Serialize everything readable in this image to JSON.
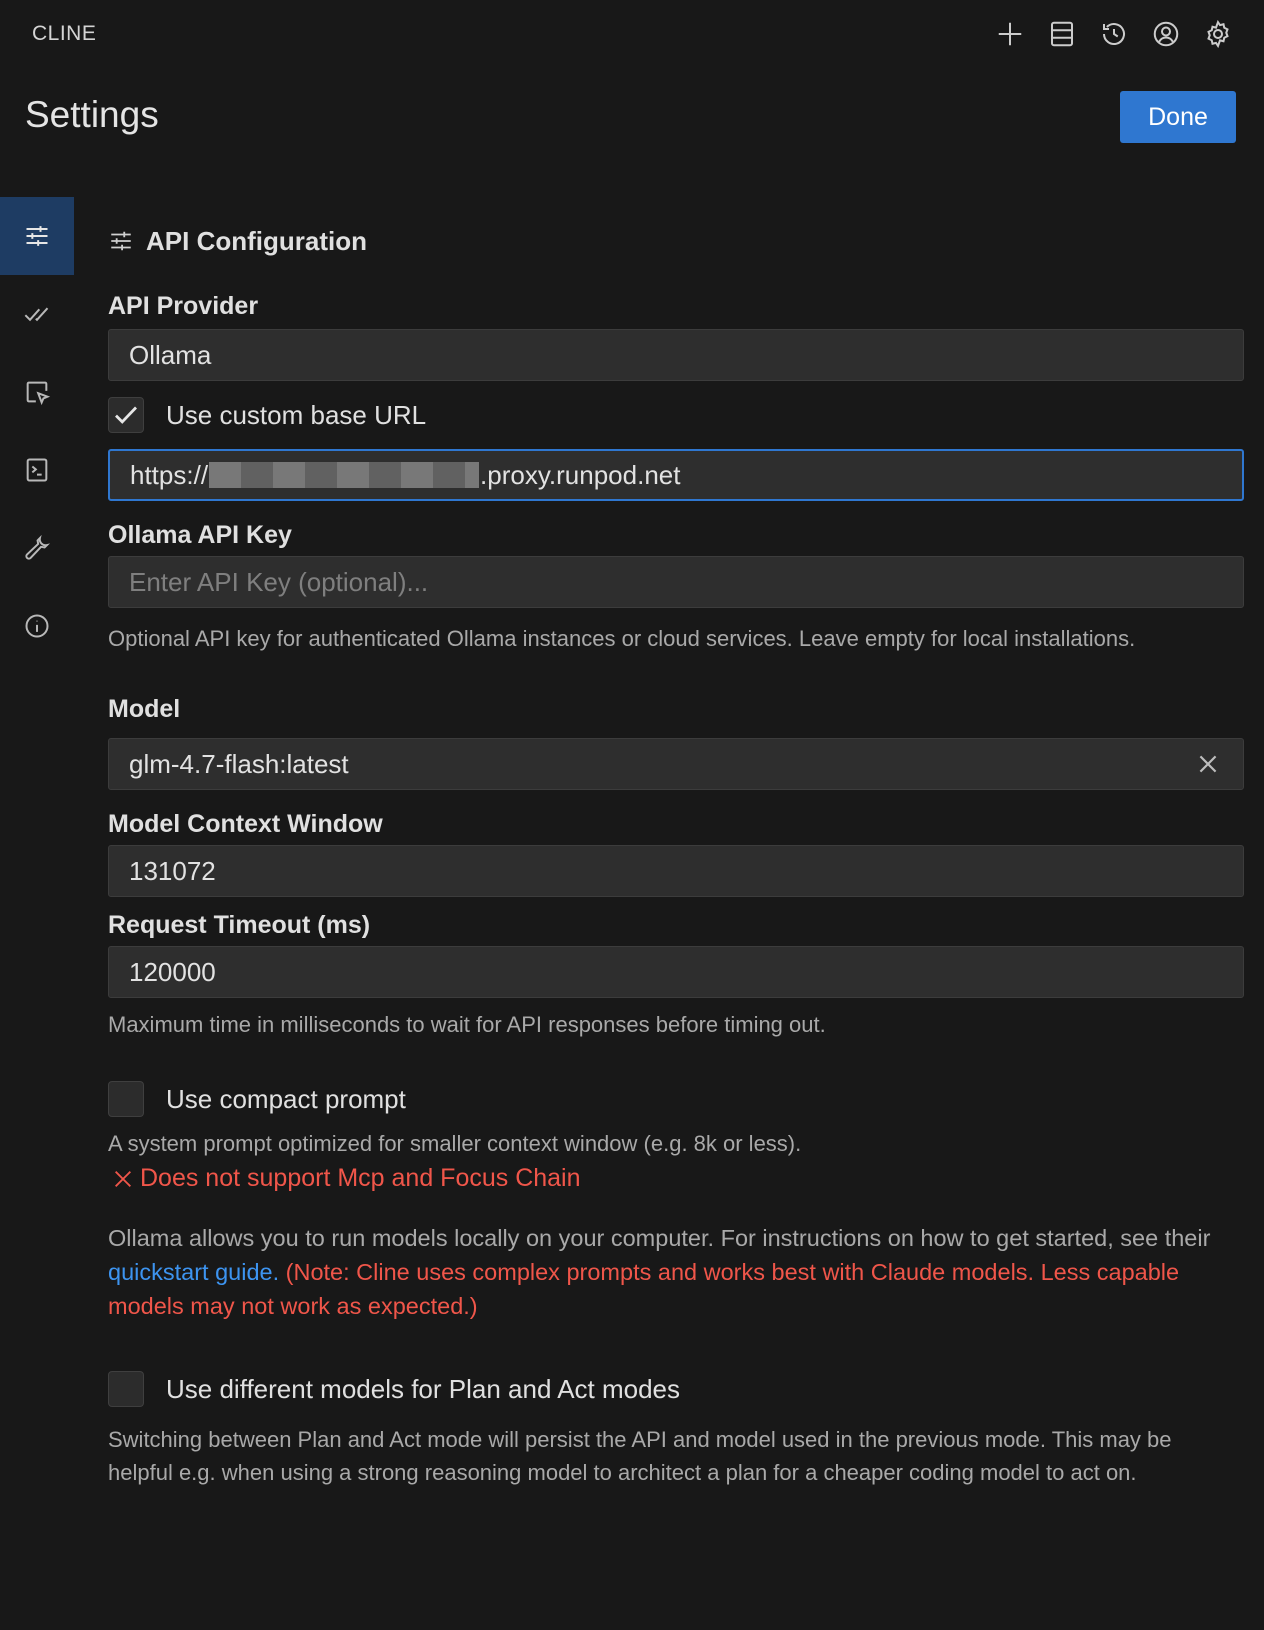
{
  "app": {
    "title": "CLINE"
  },
  "toolbar": {
    "icons": [
      "plus-icon",
      "server-icon",
      "history-icon",
      "account-icon",
      "gear-icon"
    ]
  },
  "header": {
    "title": "Settings",
    "done_label": "Done"
  },
  "sidebar": {
    "items": [
      {
        "icon": "sliders-icon",
        "active": true
      },
      {
        "icon": "check-check-icon",
        "active": false
      },
      {
        "icon": "cursor-box-icon",
        "active": false
      },
      {
        "icon": "terminal-icon",
        "active": false
      },
      {
        "icon": "wrench-icon",
        "active": false
      },
      {
        "icon": "info-icon",
        "active": false
      }
    ]
  },
  "section": {
    "title": "API Configuration"
  },
  "api_provider": {
    "label": "API Provider",
    "value": "Ollama"
  },
  "custom_base_url": {
    "label": "Use custom base URL",
    "checked": true,
    "prefix": "https://",
    "suffix": ".proxy.runpod.net"
  },
  "api_key": {
    "label": "Ollama API Key",
    "placeholder": "Enter API Key (optional)...",
    "help": "Optional API key for authenticated Ollama instances or cloud services. Leave empty for local installations."
  },
  "model": {
    "label": "Model",
    "value": "glm-4.7-flash:latest"
  },
  "context_window": {
    "label": "Model Context Window",
    "value": "131072"
  },
  "timeout": {
    "label": "Request Timeout (ms)",
    "value": "120000",
    "help": "Maximum time in milliseconds to wait for API responses before timing out."
  },
  "compact_prompt": {
    "label": "Use compact prompt",
    "checked": false,
    "help": "A system prompt optimized for smaller context window (e.g. 8k or less).",
    "error": "Does not support Mcp and Focus Chain"
  },
  "ollama_info": {
    "text_before": "Ollama allows you to run models locally on your computer. For instructions on how to get started, see their ",
    "link": "quickstart guide.",
    "warning": "(Note: Cline uses complex prompts and works best with Claude models. Less capable models may not work as expected.)"
  },
  "plan_act": {
    "label": "Use different models for Plan and Act modes",
    "checked": false,
    "help": "Switching between Plan and Act mode will persist the API and model used in the previous mode. This may be helpful e.g. when using a strong reasoning model to architect a plan for a cheaper coding model to act on."
  },
  "colors": {
    "background": "#181818",
    "accent": "#2f77d0",
    "link": "#3d94f0",
    "error": "#f0564a",
    "sidebar_active": "#1e3c63"
  }
}
